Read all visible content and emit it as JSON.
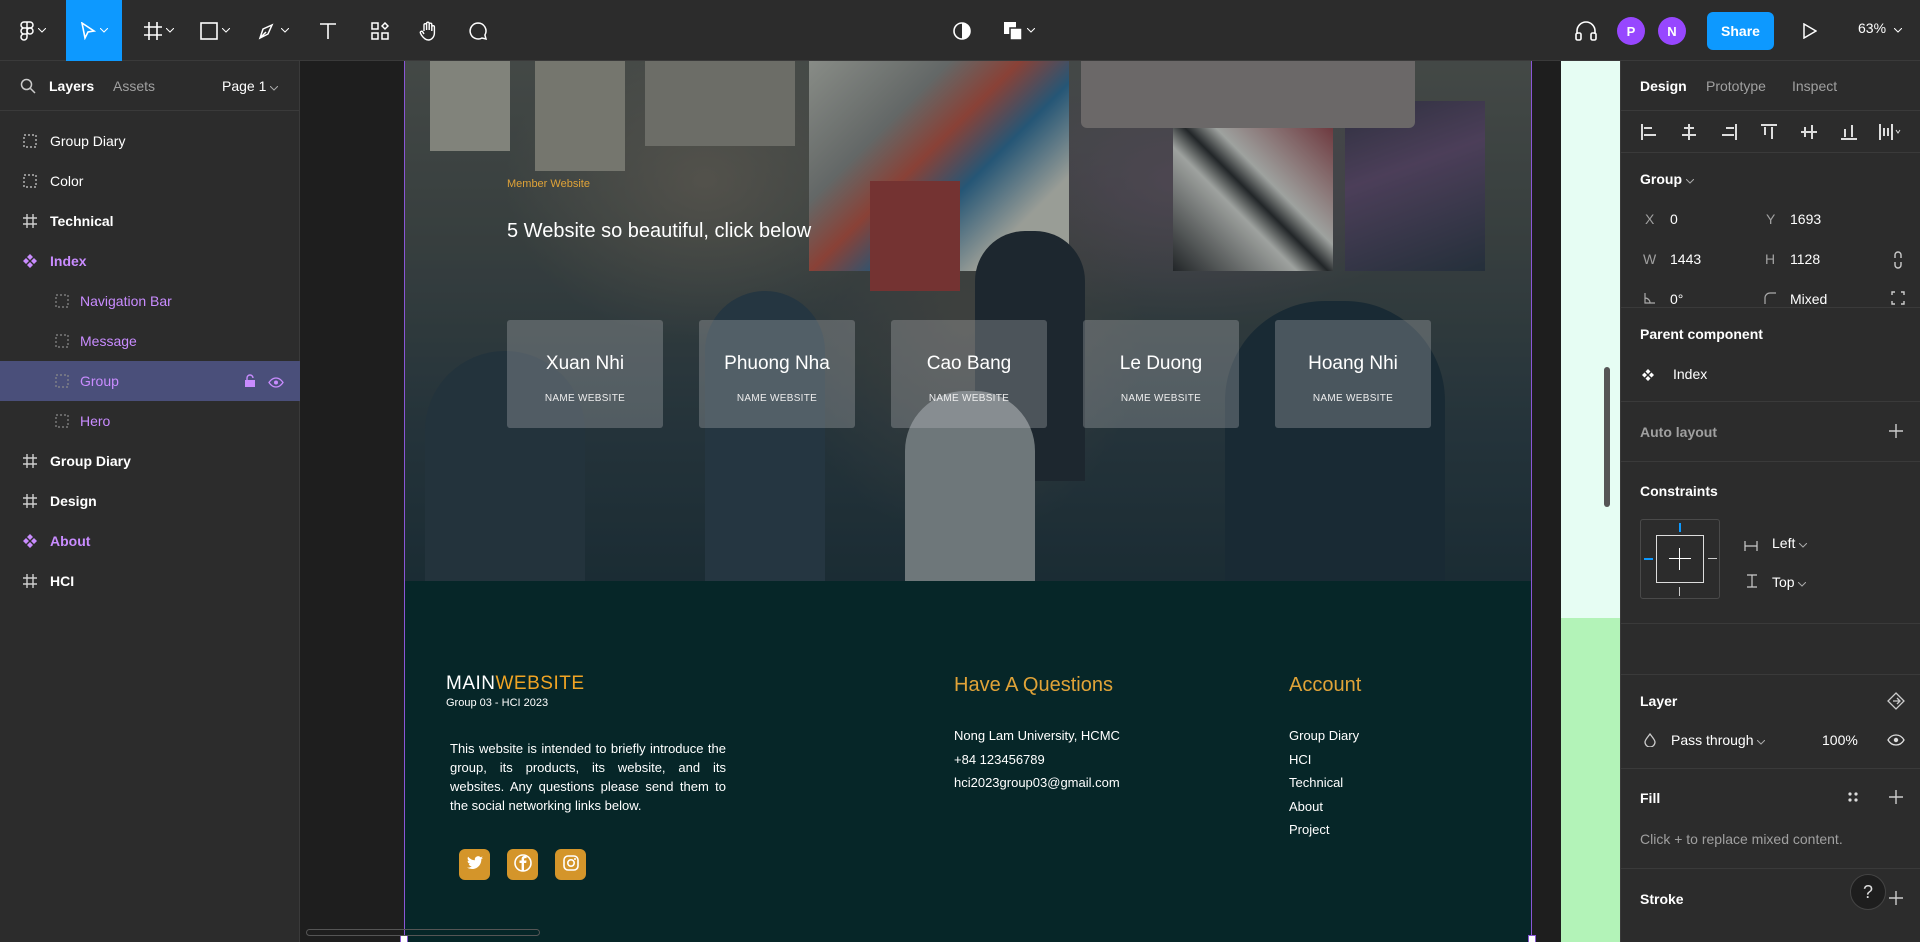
{
  "toolbar": {
    "tools": [
      "main-menu-icon",
      "move-tool-icon",
      "frame-tool-icon",
      "shape-tool-icon",
      "pen-tool-icon",
      "text-tool-icon",
      "resources-icon",
      "hand-tool-icon",
      "comment-icon"
    ],
    "center_tools": [
      "contrast-icon",
      "boolean-icon"
    ],
    "avatars": [
      {
        "letter": "P",
        "color": "#9747ff"
      },
      {
        "letter": "N",
        "color": "#9747ff"
      }
    ],
    "share_label": "Share",
    "zoom": "63%"
  },
  "left_panel": {
    "tabs": {
      "layers": "Layers",
      "assets": "Assets"
    },
    "page_selector": "Page 1",
    "layers": [
      {
        "name": "Group Diary",
        "icon": "group-icon",
        "level": 0,
        "style": "normal"
      },
      {
        "name": "Color",
        "icon": "group-icon",
        "level": 0,
        "style": "normal"
      },
      {
        "name": "Technical",
        "icon": "frame-icon",
        "level": 0,
        "style": "bold"
      },
      {
        "name": "Index",
        "icon": "component-icon",
        "level": 0,
        "style": "component"
      },
      {
        "name": "Navigation Bar",
        "icon": "group-icon",
        "level": 1,
        "style": "component-child"
      },
      {
        "name": "Message",
        "icon": "group-icon",
        "level": 1,
        "style": "component-child"
      },
      {
        "name": "Group",
        "icon": "group-icon",
        "level": 1,
        "style": "selected"
      },
      {
        "name": "Hero",
        "icon": "group-icon",
        "level": 1,
        "style": "component-child"
      },
      {
        "name": "Group Diary",
        "icon": "frame-icon",
        "level": 0,
        "style": "bold"
      },
      {
        "name": "Design",
        "icon": "frame-icon",
        "level": 0,
        "style": "bold"
      },
      {
        "name": "About",
        "icon": "component-icon",
        "level": 0,
        "style": "component"
      },
      {
        "name": "HCI",
        "icon": "frame-icon",
        "level": 0,
        "style": "bold"
      }
    ]
  },
  "canvas": {
    "hero": {
      "subtitle": "Member Website",
      "title": "5 Website so beautiful, click below",
      "cards": [
        {
          "name": "Xuan Nhi",
          "sub": "NAME WEBSITE"
        },
        {
          "name": "Phuong Nha",
          "sub": "NAME WEBSITE"
        },
        {
          "name": "Cao Bang",
          "sub": "NAME WEBSITE"
        },
        {
          "name": "Le Duong",
          "sub": "NAME WEBSITE"
        },
        {
          "name": "Hoang Nhi",
          "sub": "NAME WEBSITE"
        }
      ]
    },
    "footer": {
      "logo_main": "MAIN",
      "logo_accent": "WEBSITE",
      "logo_sub": "Group 03 - HCI 2023",
      "about": "This website is intended to briefly introduce the group, its products, its website, and its websites. Any questions please send them to the social networking links below.",
      "social": [
        "twitter-icon",
        "facebook-icon",
        "instagram-icon"
      ],
      "questions_heading": "Have A Questions",
      "questions": [
        "Nong Lam University, HCMC",
        "+84 123456789",
        "hci2023group03@gmail.com"
      ],
      "account_heading": "Account",
      "account_links": [
        "Group Diary",
        "HCI",
        "Technical",
        "About",
        "Project"
      ]
    }
  },
  "right_panel": {
    "tabs": {
      "design": "Design",
      "prototype": "Prototype",
      "inspect": "Inspect"
    },
    "group_label": "Group",
    "x_label": "X",
    "x": "0",
    "y_label": "Y",
    "y": "1693",
    "w_label": "W",
    "w": "1443",
    "h_label": "H",
    "h": "1128",
    "rotation": "0°",
    "radius": "Mixed",
    "parent_component_label": "Parent component",
    "parent_component": "Index",
    "auto_layout_label": "Auto layout",
    "constraints_label": "Constraints",
    "constraint_h": "Left",
    "constraint_v": "Top",
    "layer_label": "Layer",
    "blend_mode": "Pass through",
    "opacity": "100%",
    "fill_label": "Fill",
    "fill_note": "Click + to replace mixed content.",
    "stroke_label": "Stroke",
    "help": "?"
  }
}
